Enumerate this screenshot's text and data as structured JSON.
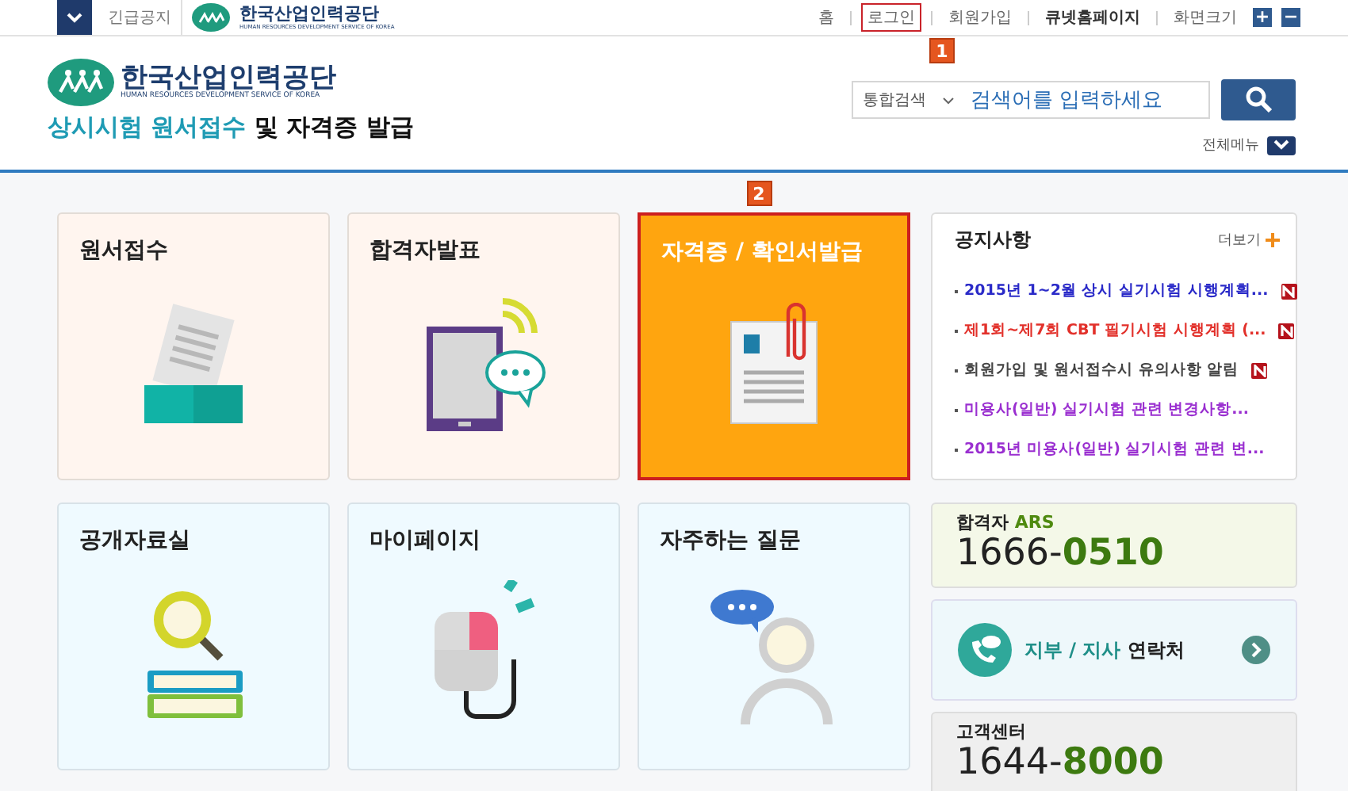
{
  "top_bar": {
    "notice_label": "긴급공지",
    "logo_name": "한국산업인력공단",
    "logo_subtitle": "HUMAN RESOURCES DEVELOPMENT SERVICE OF KOREA",
    "links": [
      {
        "label": "홈",
        "bold": false,
        "highlighted": false
      },
      {
        "label": "로그인",
        "bold": false,
        "highlighted": true
      },
      {
        "label": "회원가입",
        "bold": false,
        "highlighted": false
      },
      {
        "label": "큐넷홈페이지",
        "bold": true,
        "highlighted": false
      }
    ],
    "zoom_label": "화면크기",
    "zoom_in": "+",
    "zoom_out": "−"
  },
  "header": {
    "logo_name": "한국산업인력공단",
    "logo_subtitle": "HUMAN RESOURCES DEVELOPMENT SERVICE OF KOREA",
    "title_highlight": "상시시험 원서접수",
    "title_rest": " 및 자격증 발급",
    "search": {
      "scope": "통합검색",
      "placeholder": "검색어를 입력하세요"
    },
    "menu_label": "전체메뉴"
  },
  "callouts": [
    "1",
    "2"
  ],
  "tiles": [
    {
      "title": "원서접수",
      "kind": "application",
      "selected": false
    },
    {
      "title": "합격자발표",
      "kind": "results",
      "selected": false
    },
    {
      "title": "자격증 / 확인서발급",
      "kind": "certificate",
      "selected": true
    },
    {
      "title": "공개자료실",
      "kind": "archive",
      "selected": false
    },
    {
      "title": "마이페이지",
      "kind": "mypage",
      "selected": false
    },
    {
      "title": "자주하는 질문",
      "kind": "faq",
      "selected": false
    }
  ],
  "notices": {
    "title": "공지사항",
    "more": "더보기",
    "items": [
      {
        "text": "2015년 1~2월 상시 실기시험 시행계획...",
        "color": "#2a2ac8",
        "new": true
      },
      {
        "text": "제1회~제7회 CBT 필기시험 시행계획 (...",
        "color": "#e2302a",
        "new": true
      },
      {
        "text": "회원가입 및 원서접수시 유의사항 알림",
        "color": "#444444",
        "new": true
      },
      {
        "text": "미용사(일반) 실기시험 관련 변경사항...",
        "color": "#9a2fd0",
        "new": false
      },
      {
        "text": "2015년 미용사(일반) 실기시험 관련 변...",
        "color": "#9a2fd0",
        "new": false
      }
    ]
  },
  "ars": {
    "label": "합격자",
    "label_accent": "ARS",
    "number_prefix": "1666-",
    "number_accent": "0510"
  },
  "branch_contact": {
    "label_accent": "지부 / 지사",
    "label": "연락처"
  },
  "customer_center": {
    "label": "고객센터",
    "number_prefix": "1644-",
    "number_accent": "8000"
  }
}
